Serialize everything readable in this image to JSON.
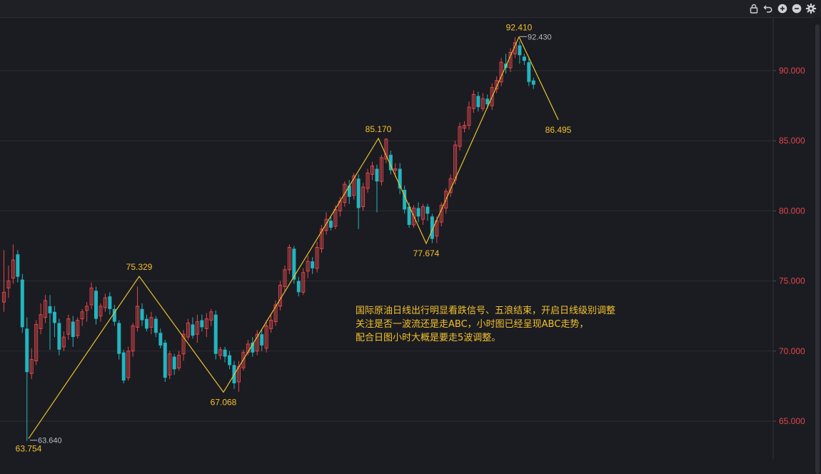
{
  "toolbar": {
    "icons": [
      "lock-icon",
      "undo-icon",
      "zoom-in-icon",
      "zoom-out-icon",
      "gear-icon"
    ]
  },
  "annotation": {
    "lines": [
      "国际原油日线出行明显看跌信号、五浪结束，开启日线级别调整",
      "关注是否一波流还是走ABC，小时图已经呈现ABC走势，",
      "配合日图小时大概是要走5波调整。"
    ]
  },
  "chart_data": {
    "type": "candlestick",
    "ylim": [
      62.5,
      93.5
    ],
    "yticks": [
      "65.000",
      "70.000",
      "75.000",
      "80.000",
      "85.000",
      "90.000"
    ],
    "grid": true,
    "colors": {
      "up": "#e0474c",
      "down": "#22b5bf",
      "wave": "#e8c22e",
      "label": "#f2c12e",
      "axis": "#e0474c"
    },
    "wave_points": [
      {
        "label": "63.754",
        "value": 63.754
      },
      {
        "label": "75.329",
        "value": 75.329
      },
      {
        "label": "67.068",
        "value": 67.068
      },
      {
        "label": "85.170",
        "value": 85.17
      },
      {
        "label": "77.674",
        "value": 77.674
      },
      {
        "label": "92.410",
        "value": 92.41
      },
      {
        "label": "86.495",
        "value": 86.495
      }
    ],
    "extreme_labels": [
      {
        "label": "63.640",
        "value": 63.64
      },
      {
        "label": "92.430",
        "value": 92.43
      }
    ],
    "candles": [
      [
        73.5,
        74.2,
        72.8,
        77.2
      ],
      [
        74.5,
        75.0,
        73.8,
        76.1
      ],
      [
        75.2,
        76.5,
        74.8,
        77.6
      ],
      [
        76.9,
        75.3,
        74.9,
        77.2
      ],
      [
        75.1,
        71.7,
        71.3,
        75.5
      ],
      [
        71.6,
        68.5,
        63.6,
        72.4
      ],
      [
        68.4,
        69.4,
        68.0,
        70.2
      ],
      [
        69.3,
        71.9,
        69.0,
        72.2
      ],
      [
        71.6,
        72.6,
        71.2,
        73.4
      ],
      [
        72.4,
        73.6,
        72.0,
        74.0
      ],
      [
        73.2,
        72.7,
        70.1,
        74.0
      ],
      [
        72.8,
        72.0,
        71.0,
        73.2
      ],
      [
        72.0,
        70.1,
        69.7,
        72.3
      ],
      [
        70.3,
        71.0,
        70.0,
        71.4
      ],
      [
        71.2,
        72.3,
        70.8,
        72.6
      ],
      [
        72.1,
        71.0,
        70.3,
        72.5
      ],
      [
        71.1,
        72.2,
        70.9,
        72.4
      ],
      [
        72.3,
        72.8,
        71.8,
        73.0
      ],
      [
        72.9,
        73.2,
        72.1,
        73.5
      ],
      [
        73.3,
        74.5,
        73.0,
        74.9
      ],
      [
        74.3,
        72.3,
        71.9,
        74.6
      ],
      [
        72.5,
        73.2,
        72.1,
        73.4
      ],
      [
        73.1,
        73.8,
        72.8,
        74.1
      ],
      [
        73.9,
        73.0,
        72.6,
        74.2
      ],
      [
        73.0,
        72.1,
        71.8,
        73.3
      ],
      [
        72.0,
        69.8,
        69.4,
        72.2
      ],
      [
        69.9,
        67.9,
        67.7,
        70.1
      ],
      [
        68.1,
        70.0,
        67.9,
        70.3
      ],
      [
        70.0,
        71.8,
        69.6,
        72.0
      ],
      [
        71.7,
        73.2,
        71.4,
        74.6
      ],
      [
        73.0,
        72.2,
        71.8,
        73.4
      ],
      [
        72.3,
        71.6,
        71.4,
        72.6
      ],
      [
        71.7,
        72.4,
        71.2,
        72.8
      ],
      [
        72.3,
        71.3,
        71.0,
        72.5
      ],
      [
        71.3,
        70.4,
        70.2,
        71.6
      ],
      [
        70.6,
        68.1,
        67.8,
        70.8
      ],
      [
        68.3,
        69.8,
        68.0,
        70.0
      ],
      [
        69.6,
        68.7,
        68.3,
        69.8
      ],
      [
        68.8,
        69.7,
        68.6,
        70.0
      ],
      [
        69.8,
        71.2,
        69.3,
        71.5
      ],
      [
        71.0,
        72.0,
        70.8,
        72.3
      ],
      [
        71.9,
        71.1,
        70.9,
        72.4
      ],
      [
        71.2,
        72.1,
        70.6,
        72.6
      ],
      [
        72.2,
        71.7,
        71.4,
        72.6
      ],
      [
        71.6,
        72.3,
        71.0,
        72.7
      ],
      [
        72.2,
        72.8,
        71.8,
        73.0
      ],
      [
        72.6,
        69.8,
        69.4,
        72.9
      ],
      [
        69.7,
        70.1,
        69.4,
        70.3
      ],
      [
        70.1,
        69.6,
        69.2,
        70.3
      ],
      [
        69.7,
        69.0,
        68.7,
        70.0
      ],
      [
        69.0,
        67.7,
        67.3,
        69.3
      ],
      [
        67.8,
        68.9,
        67.1,
        69.3
      ],
      [
        68.8,
        69.9,
        68.6,
        70.1
      ],
      [
        69.9,
        70.5,
        69.7,
        70.8
      ],
      [
        70.6,
        69.9,
        69.6,
        71.0
      ],
      [
        70.0,
        71.2,
        69.7,
        71.5
      ],
      [
        71.2,
        70.4,
        70.0,
        71.5
      ],
      [
        70.2,
        71.8,
        69.9,
        72.2
      ],
      [
        71.6,
        72.2,
        71.3,
        72.6
      ],
      [
        72.1,
        73.3,
        71.8,
        73.6
      ],
      [
        73.2,
        74.7,
        72.9,
        75.0
      ],
      [
        74.6,
        75.8,
        74.2,
        76.1
      ],
      [
        75.8,
        77.4,
        75.5,
        77.6
      ],
      [
        77.3,
        75.1,
        74.8,
        77.5
      ],
      [
        75.0,
        74.2,
        73.9,
        75.3
      ],
      [
        74.2,
        75.6,
        74.0,
        75.9
      ],
      [
        75.7,
        76.4,
        75.2,
        76.8
      ],
      [
        76.4,
        75.9,
        75.5,
        76.7
      ],
      [
        75.9,
        77.4,
        75.6,
        77.8
      ],
      [
        77.3,
        78.7,
        77.0,
        79.0
      ],
      [
        78.6,
        79.4,
        78.3,
        79.9
      ],
      [
        79.3,
        78.8,
        78.6,
        79.6
      ],
      [
        78.9,
        80.1,
        78.7,
        80.4
      ],
      [
        80.0,
        80.7,
        79.6,
        81.0
      ],
      [
        80.6,
        81.9,
        80.3,
        82.1
      ],
      [
        81.8,
        81.0,
        80.5,
        82.2
      ],
      [
        81.1,
        82.5,
        80.8,
        82.7
      ],
      [
        82.3,
        80.2,
        78.7,
        82.6
      ],
      [
        80.3,
        81.7,
        80.0,
        82.0
      ],
      [
        81.6,
        82.7,
        81.3,
        83.0
      ],
      [
        82.6,
        83.2,
        82.2,
        83.5
      ],
      [
        83.0,
        82.1,
        79.9,
        83.3
      ],
      [
        82.1,
        83.8,
        81.8,
        84.0
      ],
      [
        83.7,
        85.1,
        83.4,
        85.2
      ],
      [
        84.0,
        82.9,
        82.6,
        84.3
      ],
      [
        82.9,
        83.0,
        82.4,
        83.4
      ],
      [
        83.0,
        81.6,
        81.2,
        83.4
      ],
      [
        81.5,
        80.1,
        79.8,
        81.8
      ],
      [
        80.3,
        79.0,
        78.8,
        80.6
      ],
      [
        79.0,
        80.2,
        78.8,
        80.4
      ],
      [
        80.2,
        79.6,
        79.2,
        80.6
      ],
      [
        79.4,
        80.3,
        79.0,
        80.5
      ],
      [
        80.3,
        79.8,
        79.3,
        80.5
      ],
      [
        79.6,
        78.0,
        77.7,
        79.8
      ],
      [
        78.2,
        79.3,
        77.7,
        79.6
      ],
      [
        79.2,
        80.4,
        78.9,
        80.6
      ],
      [
        80.2,
        81.4,
        79.8,
        81.6
      ],
      [
        81.3,
        82.3,
        81.0,
        82.6
      ],
      [
        82.2,
        84.7,
        81.9,
        85.0
      ],
      [
        84.6,
        86.0,
        84.3,
        86.3
      ],
      [
        85.9,
        86.1,
        85.6,
        86.4
      ],
      [
        86.1,
        87.4,
        85.8,
        87.8
      ],
      [
        87.3,
        88.3,
        87.0,
        88.6
      ],
      [
        88.2,
        87.4,
        87.1,
        88.5
      ],
      [
        87.3,
        88.0,
        87.1,
        88.4
      ],
      [
        88.0,
        87.6,
        87.3,
        88.3
      ],
      [
        87.5,
        88.8,
        87.2,
        89.1
      ],
      [
        88.7,
        89.3,
        88.4,
        89.6
      ],
      [
        89.2,
        90.6,
        88.9,
        90.9
      ],
      [
        90.5,
        90.2,
        89.8,
        91.2
      ],
      [
        90.2,
        91.3,
        89.9,
        91.6
      ],
      [
        91.2,
        92.0,
        90.9,
        92.4
      ],
      [
        91.8,
        91.1,
        90.5,
        92.1
      ],
      [
        91.0,
        90.7,
        90.4,
        91.2
      ],
      [
        90.6,
        89.2,
        88.9,
        90.9
      ],
      [
        89.3,
        89.0,
        88.7,
        89.5
      ]
    ]
  }
}
